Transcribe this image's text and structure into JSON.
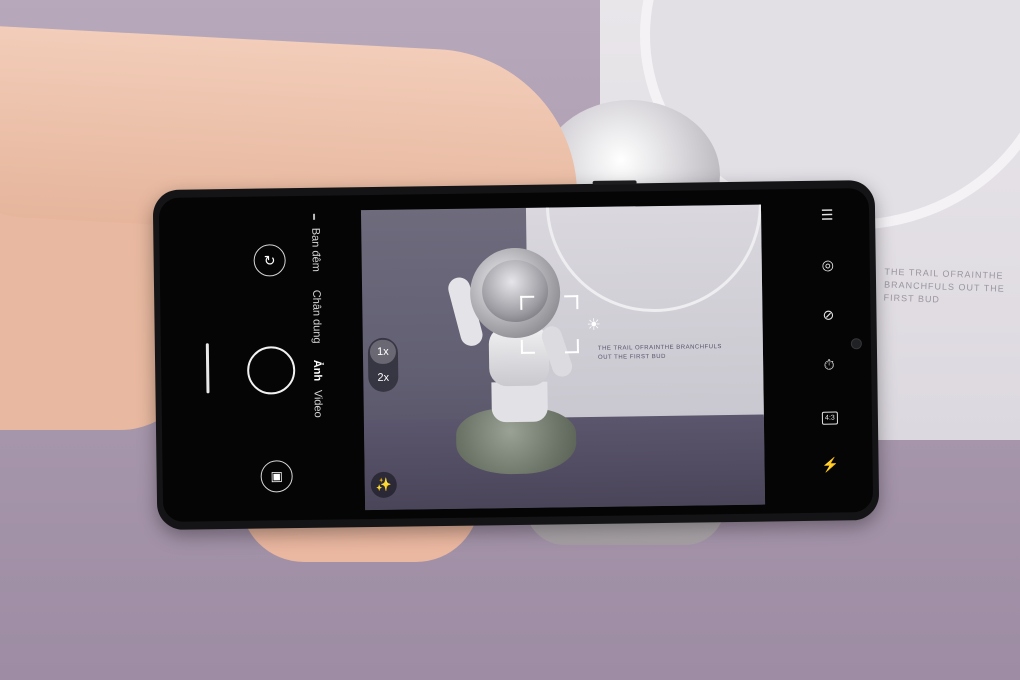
{
  "background": {
    "box_text": "THE TRAIL OFRAINTHE BRANCHFULS OUT THE FIRST BUD"
  },
  "camera_app": {
    "modes": [
      {
        "label": "Ban đêm",
        "active": false
      },
      {
        "label": "Chân dung",
        "active": false
      },
      {
        "label": "Ảnh",
        "active": true
      },
      {
        "label": "Video",
        "active": false
      }
    ],
    "zoom": {
      "options": [
        "1x",
        "2x"
      ],
      "selected": "1x"
    },
    "viewfinder_text": "THE TRAIL OFRAINTHE BRANCHFULS OUT THE FIRST BUD",
    "aspect_ratio": "4:3",
    "icons": {
      "switch_camera": "switch-camera-icon",
      "gallery": "gallery-icon",
      "menu": "menu-icon",
      "google_lens": "lens-icon",
      "ai_filter": "ai-off-icon",
      "timer": "timer-off-icon",
      "flash": "flash-off-icon",
      "exposure": "sun-icon",
      "magic": "magic-wand-icon"
    },
    "colors": {
      "screen": "#050505",
      "active_mode": "#ffffff",
      "inactive_mode": "#d5d5d5"
    }
  }
}
